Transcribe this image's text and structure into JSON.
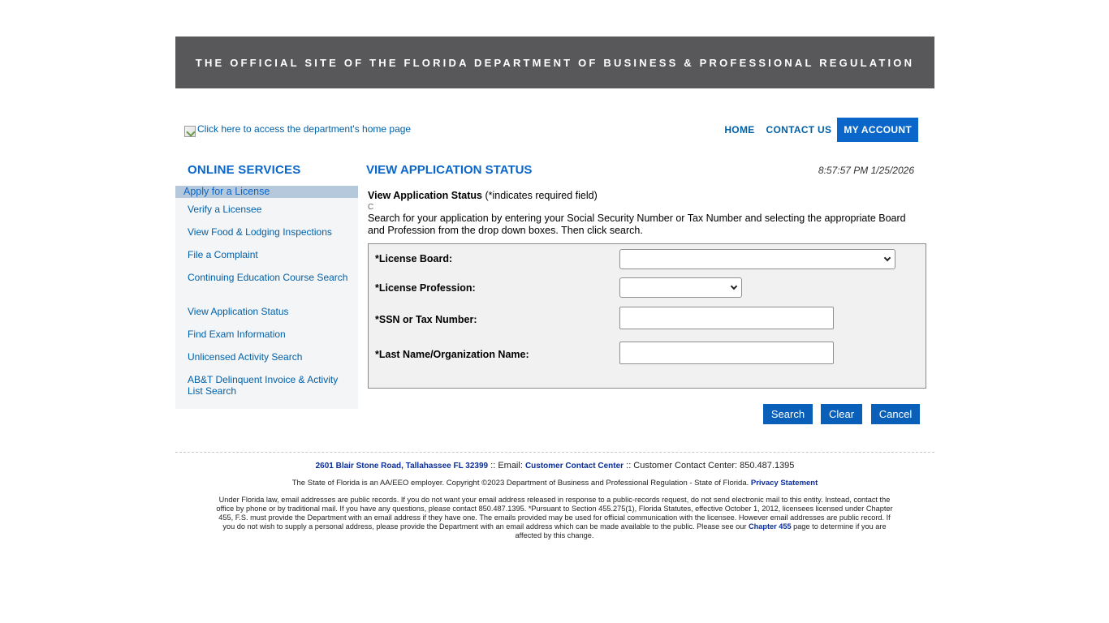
{
  "banner": {
    "text": "THE OFFICIAL SITE OF THE FLORIDA DEPARTMENT OF BUSINESS & PROFESSIONAL REGULATION"
  },
  "logo": {
    "alt_text": "Click here to access the department's home page"
  },
  "topnav": {
    "items": [
      {
        "label": "HOME"
      },
      {
        "label": "CONTACT US"
      },
      {
        "label": "MY ACCOUNT"
      }
    ]
  },
  "sidebar": {
    "title": "ONLINE SERVICES",
    "active_item": "Apply for a License",
    "items": [
      {
        "label": "Verify a Licensee"
      },
      {
        "label": "View Food & Lodging Inspections"
      },
      {
        "label": "File a Complaint"
      },
      {
        "label": "Continuing Education Course Search"
      },
      {
        "label": "View Application Status"
      },
      {
        "label": "Find Exam Information"
      },
      {
        "label": "Unlicensed Activity Search"
      },
      {
        "label": "AB&T Delinquent Invoice & Activity List Search"
      }
    ]
  },
  "main": {
    "title": "VIEW APPLICATION STATUS",
    "timestamp": "8:57:57 PM 1/25/2026",
    "form_heading": "View Application Status",
    "form_heading_note": "(*indicates required field)",
    "stray_char": "C",
    "instructions": "Search for your application by entering your Social Security Number or Tax Number and selecting the appropriate Board and Profession from the drop down boxes. Then click search."
  },
  "form": {
    "license_board_label": "*License Board:",
    "license_profession_label": "*License Profession:",
    "ssn_label": "*SSN or Tax Number:",
    "last_name_label": "*Last Name/Organization Name:",
    "license_board_value": "",
    "license_profession_value": "",
    "ssn_value": "",
    "last_name_value": ""
  },
  "buttons": {
    "search": "Search",
    "clear": "Clear",
    "cancel": "Cancel"
  },
  "footer": {
    "address": "2601 Blair Stone Road, Tallahassee FL 32399",
    "email_sep": " :: Email: ",
    "email_link": "Customer Contact Center",
    "phone_text": " :: Customer Contact Center: 850.487.1395",
    "eeo_text": "The State of Florida is an AA/EEO employer. Copyright ©2023 Department of Business and Professional Regulation - State of Florida. ",
    "privacy_link": "Privacy Statement",
    "legal_text": "Under Florida law, email addresses are public records. If you do not want your email address released in response to a public-records request, do not send electronic mail to this entity. Instead, contact the office by phone or by traditional mail. If you have any questions, please contact 850.487.1395. *Pursuant to Section 455.275(1), Florida Statutes, effective October 1, 2012, licensees licensed under Chapter 455, F.S. must provide the Department with an email address if they have one. The emails provided may be used for official communication with the licensee. However email addresses are public record. If you do not wish to supply a personal address, please provide the Department with an email address which can be made available to the public. Please see our ",
    "chapter_link": "Chapter 455",
    "legal_tail": " page to determine if you are affected by this change."
  },
  "colors": {
    "banner_bg": "#58575a",
    "accent_blue": "#0a66c9",
    "button_blue": "#0a5fb8",
    "sidebar_bg": "#f4f5f6",
    "sidebar_active_bg": "#b6c9dc",
    "form_bg": "#f1f1f1"
  }
}
